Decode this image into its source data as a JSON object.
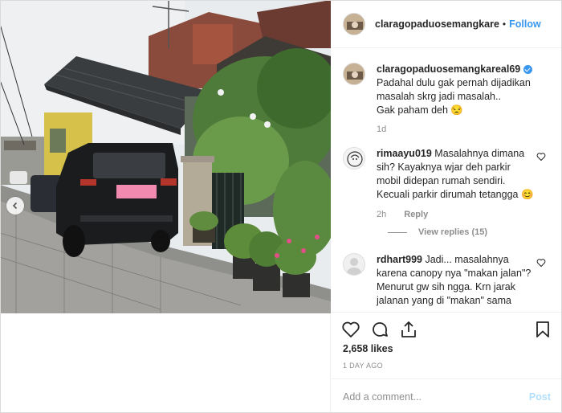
{
  "post": {
    "author": "claragopaduosemangkare",
    "follow_label": "Follow",
    "dot": "•"
  },
  "caption": {
    "author": "claragopaduosemangkareal69",
    "text_lines": [
      "Padahal dulu gak pernah dijadikan",
      "masalah skrg jadi masalah..",
      "Gak paham deh 😒"
    ],
    "time": "1d"
  },
  "comments": [
    {
      "author": "rimaayu019",
      "text": "Masalahnya dimana sih? Kayaknya wjar deh parkir mobil didepan rumah sendiri. Kecuali parkir dirumah tetangga 😊",
      "time": "2h",
      "reply_label": "Reply",
      "view_replies": "View replies (15)"
    },
    {
      "author": "rdhart999",
      "text": "Jadi... masalahnya karena canopy nya \"makan jalan\"? Menurut gw sih ngga. Krn jarak jalanan yang di \"makan\" sama"
    }
  ],
  "actions": {
    "likes": "2,658 likes",
    "ago": "1 DAY AGO",
    "comment_placeholder": "Add a comment...",
    "post_label": "Post"
  },
  "icons": [
    "chevron-left-icon",
    "heart-icon",
    "comment-icon",
    "share-icon",
    "bookmark-icon",
    "verified-icon"
  ],
  "colors": {
    "accent": "#3897f0",
    "muted": "#8e8e8e",
    "post_disabled": "#b2dffc"
  }
}
